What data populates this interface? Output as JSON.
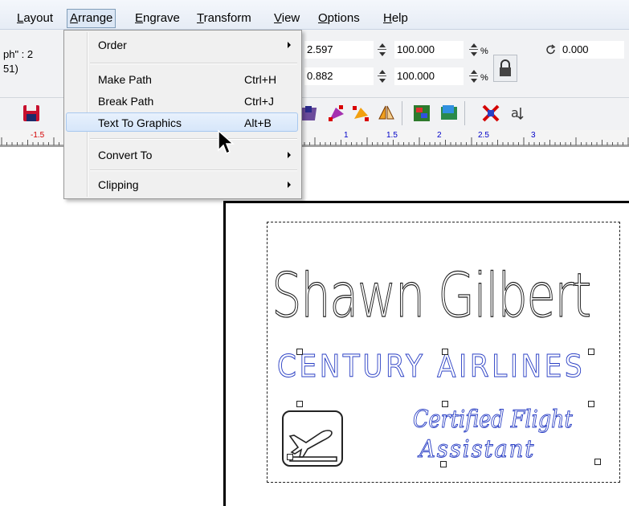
{
  "menubar": {
    "items": [
      {
        "label": "Layout",
        "mnemonic": "L"
      },
      {
        "label": "Arrange",
        "mnemonic": "A",
        "active": true
      },
      {
        "label": "Engrave",
        "mnemonic": "E"
      },
      {
        "label": "Transform",
        "mnemonic": "T"
      },
      {
        "label": "View",
        "mnemonic": "V"
      },
      {
        "label": "Options",
        "mnemonic": "O"
      },
      {
        "label": "Help",
        "mnemonic": "H"
      }
    ]
  },
  "properties": {
    "font_partial_1": "ph\" : 2",
    "font_partial_2": "51)",
    "x_value": "2.597",
    "y_value": "0.882",
    "scale_w": "100.000",
    "scale_h": "100.000",
    "pct_symbol": "%",
    "rotation": "0.000"
  },
  "ruler": {
    "labels": [
      "-1.5",
      "1",
      "1.5",
      "2",
      "2.5",
      "3"
    ]
  },
  "arrange_menu": {
    "items": [
      {
        "label": "Order",
        "shortcut": "",
        "submenu": true
      },
      {
        "label": "Make Path",
        "shortcut": "Ctrl+H",
        "submenu": false
      },
      {
        "label": "Break Path",
        "shortcut": "Ctrl+J",
        "submenu": false
      },
      {
        "label": "Text To Graphics",
        "shortcut": "Alt+B",
        "submenu": false,
        "highlighted": true
      },
      {
        "label": "Convert To",
        "shortcut": "",
        "submenu": true
      },
      {
        "label": "Clipping",
        "shortcut": "",
        "submenu": true
      }
    ]
  },
  "design": {
    "name": "Shawn Gilbert",
    "airline": "CENTURY AIRLINES",
    "cert_line1": "Certified Flight",
    "cert_line2": "Assistant"
  },
  "colors": {
    "outline_dark": "#222222",
    "outline_blue": "#2a3fc4",
    "ruler_pos": "#0000c8",
    "ruler_neg": "#d40000",
    "menu_highlight": "#d6e6fa"
  },
  "icons": {
    "rotate": "rotate-icon",
    "lock": "lock-icon",
    "plane": "airplane-departure-icon"
  }
}
